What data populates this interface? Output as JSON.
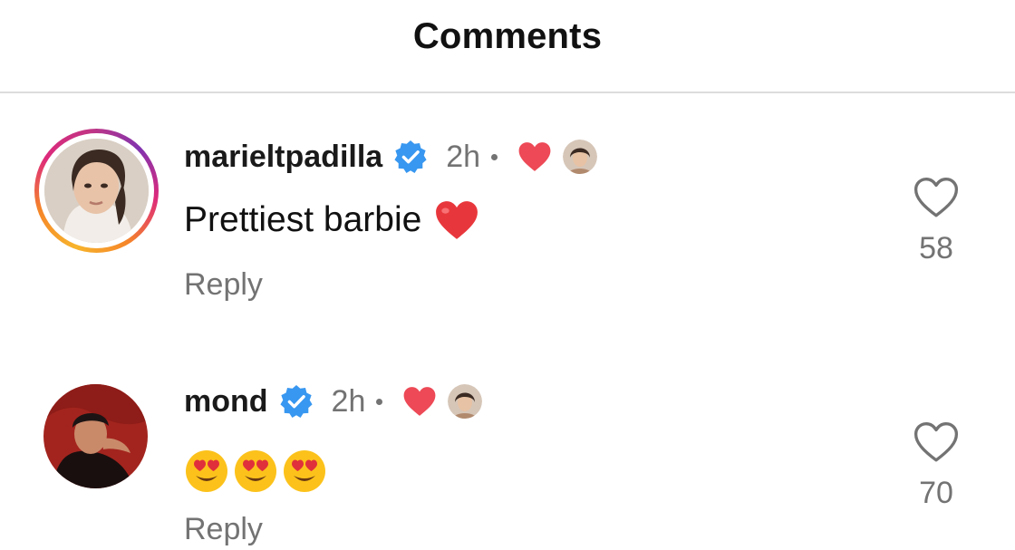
{
  "header": {
    "title": "Comments"
  },
  "colors": {
    "verified_blue": "#3897f0",
    "like_red": "#ed4956",
    "secondary_text": "#737373"
  },
  "comments": [
    {
      "username": "marieltpadilla",
      "verified": true,
      "time": "2h",
      "liked_by_creator": true,
      "text": "Prettiest barbie",
      "text_emoji": "red-heart",
      "reply_label": "Reply",
      "like_count": "58",
      "story_ring": true
    },
    {
      "username": "mond",
      "verified": true,
      "time": "2h",
      "liked_by_creator": true,
      "text": "",
      "text_emoji": "heart-eyes x3",
      "reply_label": "Reply",
      "like_count": "70",
      "story_ring": false
    }
  ]
}
